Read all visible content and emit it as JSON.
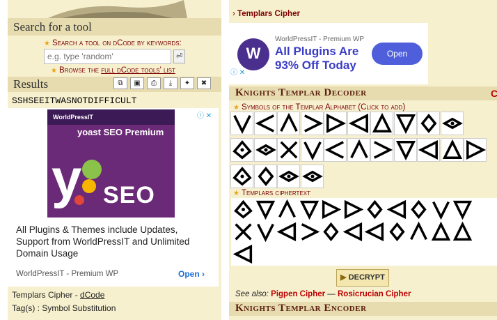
{
  "left": {
    "search": {
      "title": "Search for a tool",
      "keywords_label": "Search a tool on dCode by keywords:",
      "placeholder": "e.g. type 'random'",
      "go_icon": "enter-icon",
      "browse_prefix": "Browse the ",
      "browse_link": "full dCode tools' list"
    },
    "results": {
      "title": "Results",
      "tools": [
        "copy-icon",
        "save-icon",
        "print-icon",
        "download-icon",
        "pin-icon",
        "close-icon"
      ],
      "text": "SSHSEEITWASNOTDIFFICULT"
    },
    "ad": {
      "brand": "WorldPressIT",
      "product": "yoast SEO Premium",
      "seo": "SEO",
      "headline": "All Plugins & Themes include Updates, Support from WorldPressIT and Unlimited Domain Usage",
      "source": "WorldPressIT - Premium WP",
      "open": "Open",
      "open_arrow": "›",
      "choices": "ⓘ ✕"
    },
    "footer": {
      "cipher_prefix": "Templars Cipher - ",
      "cipher_link": "dCode",
      "tags": "Tag(s) : Symbol Substitution"
    }
  },
  "right": {
    "crumb_arrow": "›",
    "crumb": "Templars Cipher",
    "ad": {
      "logo": "W",
      "brand": "WorldPressIT - Premium WP",
      "line1": "All Plugins Are",
      "line2": "93% Off Today",
      "open": "Open",
      "choices": "ⓘ ✕"
    },
    "decoder": {
      "title": "Knights Templar Decoder",
      "symbols_label": "Symbols of the Templar Alphabet (Click to add)",
      "symbol_keys": [
        "V",
        "<",
        "^",
        ">",
        "R",
        "L",
        "A",
        "v",
        "d",
        "l",
        "a",
        "r",
        "X",
        "V",
        "<",
        "^",
        ">",
        "v",
        "L",
        "A",
        "R",
        "a",
        "d",
        "l",
        "r"
      ],
      "ciphertext_label": "Templars ciphertext",
      "ciphertext": [
        "a",
        "v",
        "^",
        "v",
        "R",
        "R",
        "d",
        "L",
        "d",
        "V",
        "v",
        "X",
        "V",
        "L",
        ">",
        "d",
        "L",
        "L",
        "d",
        "^",
        "A",
        "A",
        "L"
      ],
      "decrypt": "DECRYPT",
      "decrypt_icon": "▶",
      "see_also_label": "See also:",
      "see_also_1": "Pigpen Cipher",
      "see_also_sep": " — ",
      "see_also_2": "Rosicrucian Cipher"
    },
    "encoder": {
      "title": "Knights Templar Encoder"
    },
    "side_letter": "C"
  },
  "colors": {
    "panel": "#f7f0cf",
    "header": "#e7dcb0",
    "link_red": "#7a0000",
    "title_brown": "#5a1e0c"
  }
}
